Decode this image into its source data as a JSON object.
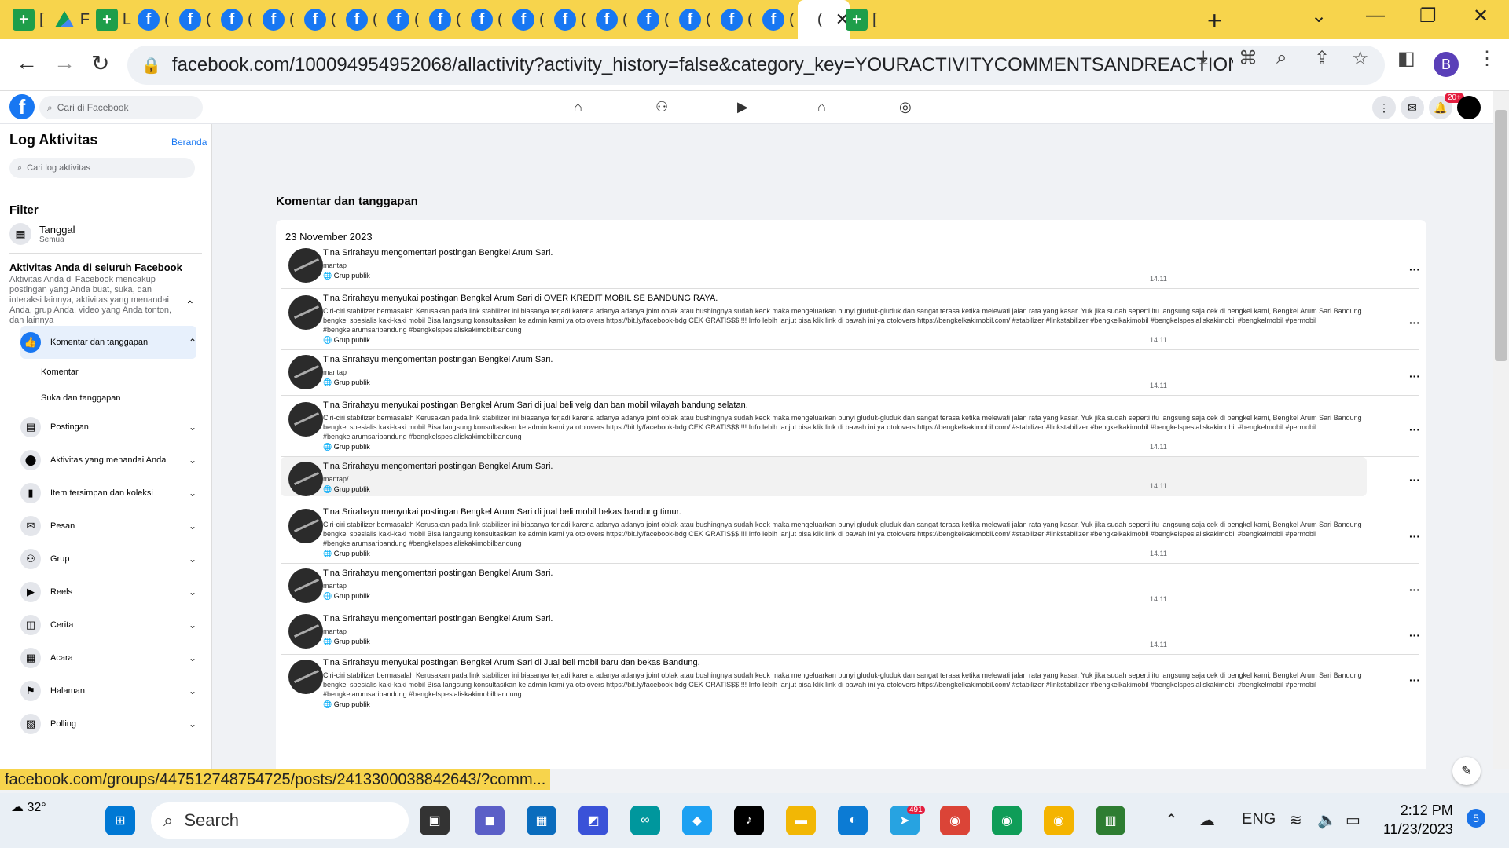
{
  "browser": {
    "tabs": [
      {
        "icon": "sheet-icon",
        "letter": "[",
        "active": false
      },
      {
        "icon": "drive-icon",
        "letter": "F",
        "active": false
      },
      {
        "icon": "sheet-icon",
        "letter": "L",
        "active": false
      },
      {
        "icon": "facebook-icon",
        "letter": "(",
        "active": false
      },
      {
        "icon": "facebook-icon",
        "letter": "(",
        "active": false
      },
      {
        "icon": "facebook-icon",
        "letter": "(",
        "active": false
      },
      {
        "icon": "facebook-icon",
        "letter": "(",
        "active": false
      },
      {
        "icon": "facebook-icon",
        "letter": "(",
        "active": false
      },
      {
        "icon": "facebook-icon",
        "letter": "(",
        "active": false
      },
      {
        "icon": "facebook-icon",
        "letter": "(",
        "active": false
      },
      {
        "icon": "facebook-icon",
        "letter": "(",
        "active": false
      },
      {
        "icon": "facebook-icon",
        "letter": "(",
        "active": false
      },
      {
        "icon": "facebook-icon",
        "letter": "(",
        "active": false
      },
      {
        "icon": "facebook-icon",
        "letter": "(",
        "active": false
      },
      {
        "icon": "facebook-icon",
        "letter": "(",
        "active": false
      },
      {
        "icon": "facebook-icon",
        "letter": "(",
        "active": false
      },
      {
        "icon": "facebook-icon",
        "letter": "(",
        "active": false
      },
      {
        "icon": "facebook-icon",
        "letter": "(",
        "active": false
      },
      {
        "icon": "facebook-icon",
        "letter": "(",
        "active": false
      },
      {
        "icon": "loading-icon",
        "letter": "(",
        "active": true
      },
      {
        "icon": "sheet-icon",
        "letter": "[",
        "active": false
      }
    ],
    "url": "facebook.com/100094954952068/allactivity?activity_history=false&category_key=YOURACTIVITYCOMMENTSANDREACTIONSSCHEMA&m...",
    "profile_letter": "B",
    "status_url": "facebook.com/groups/447512748754725/posts/2413300038842643/?comm..."
  },
  "fb_header": {
    "search_placeholder": "Cari di Facebook",
    "notif_badge": "20+"
  },
  "sidebar": {
    "title": "Log Aktivitas",
    "home_link": "Beranda",
    "search_placeholder": "Cari log aktivitas",
    "filter_label": "Filter",
    "date_filter": {
      "label": "Tanggal",
      "value": "Semua"
    },
    "activity_heading": "Aktivitas Anda di seluruh Facebook",
    "activity_desc": "Aktivitas Anda di Facebook mencakup postingan yang Anda buat, suka, dan interaksi lainnya, aktivitas yang menandai Anda, grup Anda, video yang Anda tonton, dan lainnya",
    "categories": [
      {
        "label": "Komentar dan tanggapan",
        "icon": "thumbs-up-icon",
        "glyph": "👍",
        "selected": true,
        "chev": "⌃"
      },
      {
        "label": "Postingan",
        "icon": "posts-icon",
        "glyph": "▤",
        "selected": false,
        "chev": "⌄"
      },
      {
        "label": "Aktivitas yang menandai Anda",
        "icon": "tag-icon",
        "glyph": "⬤",
        "selected": false,
        "chev": "⌄"
      },
      {
        "label": "Item tersimpan dan koleksi",
        "icon": "bookmark-icon",
        "glyph": "▮",
        "selected": false,
        "chev": "⌄"
      },
      {
        "label": "Pesan",
        "icon": "messenger-icon",
        "glyph": "✉",
        "selected": false,
        "chev": "⌄"
      },
      {
        "label": "Grup",
        "icon": "groups-icon",
        "glyph": "⚇",
        "selected": false,
        "chev": "⌄"
      },
      {
        "label": "Reels",
        "icon": "reels-icon",
        "glyph": "▶",
        "selected": false,
        "chev": "⌄"
      },
      {
        "label": "Cerita",
        "icon": "stories-icon",
        "glyph": "◫",
        "selected": false,
        "chev": "⌄"
      },
      {
        "label": "Acara",
        "icon": "calendar-icon",
        "glyph": "▦",
        "selected": false,
        "chev": "⌄"
      },
      {
        "label": "Halaman",
        "icon": "flag-icon",
        "glyph": "⚑",
        "selected": false,
        "chev": "⌄"
      },
      {
        "label": "Polling",
        "icon": "poll-icon",
        "glyph": "▧",
        "selected": false,
        "chev": "⌄"
      }
    ],
    "subitems": [
      "Komentar",
      "Suka dan tanggapan"
    ]
  },
  "main": {
    "section_title": "Komentar dan tanggapan",
    "date_header": "23 November 2023",
    "entries": [
      {
        "actor": "Tina Srirahayu",
        "action": " mengomentari postingan ",
        "target": "Bengkel Arum Sari",
        "group": "",
        "suffix": ".",
        "body": "mantap",
        "audience": "Grup publik",
        "time": "14.11"
      },
      {
        "actor": "Tina Srirahayu",
        "action": " menyukai postingan ",
        "target": "Bengkel Arum Sari",
        "group": "OVER KREDIT MOBIL SE BANDUNG RAYA",
        "suffix": ".",
        "body": "Ciri-ciri stabilizer bermasalah Kerusakan pada link stabilizer ini biasanya terjadi karena adanya adanya joint oblak atau bushingnya sudah keok maka mengeluarkan bunyi gluduk-gluduk dan sangat terasa ketika melewati jalan rata yang kasar. Yuk jika sudah seperti itu langsung saja cek di bengkel kami, Bengkel Arum Sari Bandung bengkel spesialis kaki-kaki mobil Bisa langsung konsultasikan ke admin kami ya otolovers https://bit.ly/facebook-bdg CEK GRATIS$$!!!! Info lebih lanjut bisa klik link di bawah ini ya otolovers https://bengkelkakimobil.com/ #stabilizer #linkstabilizer #bengkelkakimobil #bengkelspesialiskakimobil #bengkelmobil #permobil #bengkelarumsaribandung #bengkelspesialiskakimobilbandung",
        "audience": "Grup publik",
        "time": "14.11"
      },
      {
        "actor": "Tina Srirahayu",
        "action": " mengomentari postingan ",
        "target": "Bengkel Arum Sari",
        "group": "",
        "suffix": ".",
        "body": "mantap",
        "audience": "Grup publik",
        "time": "14.11"
      },
      {
        "actor": "Tina Srirahayu",
        "action": " menyukai postingan ",
        "target": "Bengkel Arum Sari",
        "group": "jual beli velg dan ban mobil wilayah bandung selatan",
        "suffix": ".",
        "body": "Ciri-ciri stabilizer bermasalah Kerusakan pada link stabilizer ini biasanya terjadi karena adanya adanya joint oblak atau bushingnya sudah keok maka mengeluarkan bunyi gluduk-gluduk dan sangat terasa ketika melewati jalan rata yang kasar. Yuk jika sudah seperti itu langsung saja cek di bengkel kami, Bengkel Arum Sari Bandung bengkel spesialis kaki-kaki mobil Bisa langsung konsultasikan ke admin kami ya otolovers https://bit.ly/facebook-bdg CEK GRATIS$$!!!! Info lebih lanjut bisa klik link di bawah ini ya otolovers https://bengkelkakimobil.com/ #stabilizer #linkstabilizer #bengkelkakimobil #bengkelspesialiskakimobil #bengkelmobil #permobil #bengkelarumsaribandung #bengkelspesialiskakimobilbandung",
        "audience": "Grup publik",
        "time": "14.11"
      },
      {
        "actor": "Tina Srirahayu",
        "action": " mengomentari postingan ",
        "target": "Bengkel Arum Sari",
        "group": "",
        "suffix": ".",
        "body": "mantap/",
        "audience": "Grup publik",
        "time": "14.11"
      },
      {
        "actor": "Tina Srirahayu",
        "action": " menyukai postingan ",
        "target": "Bengkel Arum Sari",
        "group": "jual beli mobil bekas bandung timur",
        "suffix": ".",
        "body": "Ciri-ciri stabilizer bermasalah Kerusakan pada link stabilizer ini biasanya terjadi karena adanya adanya joint oblak atau bushingnya sudah keok maka mengeluarkan bunyi gluduk-gluduk dan sangat terasa ketika melewati jalan rata yang kasar. Yuk jika sudah seperti itu langsung saja cek di bengkel kami, Bengkel Arum Sari Bandung bengkel spesialis kaki-kaki mobil Bisa langsung konsultasikan ke admin kami ya otolovers https://bit.ly/facebook-bdg CEK GRATIS$$!!!! Info lebih lanjut bisa klik link di bawah ini ya otolovers https://bengkelkakimobil.com/ #stabilizer #linkstabilizer #bengkelkakimobil #bengkelspesialiskakimobil #bengkelmobil #permobil #bengkelarumsaribandung #bengkelspesialiskakimobilbandung",
        "audience": "Grup publik",
        "time": "14.11"
      },
      {
        "actor": "Tina Srirahayu",
        "action": " mengomentari postingan ",
        "target": "Bengkel Arum Sari",
        "group": "",
        "suffix": ".",
        "body": "mantap",
        "audience": "Grup publik",
        "time": "14.11"
      },
      {
        "actor": "Tina Srirahayu",
        "action": " mengomentari postingan ",
        "target": "Bengkel Arum Sari",
        "group": "",
        "suffix": ".",
        "body": "mantap",
        "audience": "Grup publik",
        "time": "14.11"
      },
      {
        "actor": "Tina Srirahayu",
        "action": " menyukai postingan ",
        "target": "Bengkel Arum Sari",
        "group": "Jual beli mobil baru dan bekas Bandung",
        "suffix": ".",
        "body": "Ciri-ciri stabilizer bermasalah Kerusakan pada link stabilizer ini biasanya terjadi karena adanya adanya joint oblak atau bushingnya sudah keok maka mengeluarkan bunyi gluduk-gluduk dan sangat terasa ketika melewati jalan rata yang kasar. Yuk jika sudah seperti itu langsung saja cek di bengkel kami, Bengkel Arum Sari Bandung bengkel spesialis kaki-kaki mobil Bisa langsung konsultasikan ke admin kami ya otolovers https://bit.ly/facebook-bdg CEK GRATIS$$!!!! Info lebih lanjut bisa klik link di bawah ini ya otolovers https://bengkelkakimobil.com/ #stabilizer #linkstabilizer #bengkelkakimobil #bengkelspesialiskakimobil #bengkelmobil #permobil #bengkelarumsaribandung #bengkelspesialiskakimobilbandung",
        "audience": "Grup publik",
        "time": ""
      }
    ]
  },
  "taskbar": {
    "temperature": "32°",
    "search_label": "Search",
    "telegram_badge": "491",
    "language": "ENG",
    "time": "2:12 PM",
    "date": "11/23/2023",
    "notification_count": "5"
  }
}
